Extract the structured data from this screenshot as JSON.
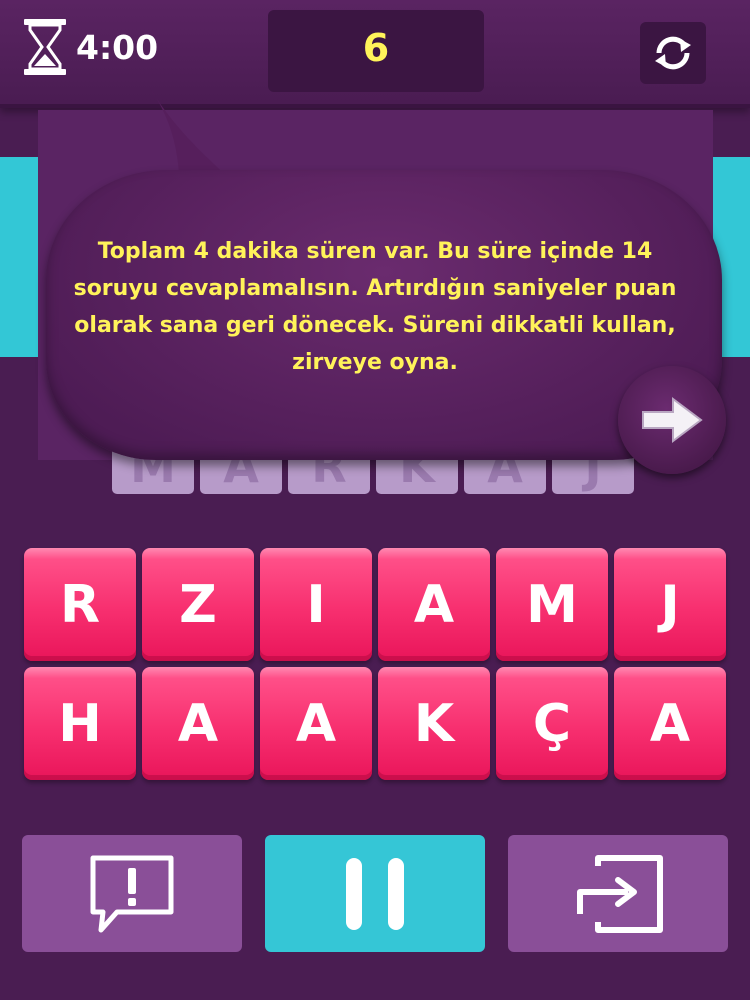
{
  "header": {
    "timer": "4:00",
    "score": "6",
    "icons": {
      "timer": "hourglass-icon",
      "refresh": "refresh-icon"
    }
  },
  "answer": {
    "letters": [
      "M",
      "A",
      "R",
      "K",
      "A",
      "J"
    ]
  },
  "tutorial": {
    "text": "Toplam 4 dakika süren var. Bu süre içinde 14 soruyu cevaplamalısın. Artırdığın saniyeler puan olarak sana geri dönecek. Süreni dikkatli kullan, zirveye oyna.",
    "next_icon": "arrow-right-icon"
  },
  "letters": {
    "row1": [
      "R",
      "Z",
      "I",
      "A",
      "M",
      "J"
    ],
    "row2": [
      "H",
      "A",
      "A",
      "K",
      "Ç",
      "A"
    ]
  },
  "controls": {
    "hint_icon": "alert-speech-icon",
    "pause_icon": "pause-icon",
    "skip_icon": "share-icon"
  },
  "colors": {
    "background": "#4a1d52",
    "accent_cyan": "#33c7d6",
    "tile_pink": "#f72f6f",
    "text_yellow": "#fff35a"
  }
}
